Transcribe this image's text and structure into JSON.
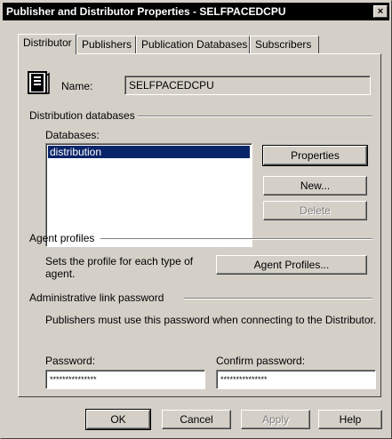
{
  "window": {
    "title": "Publisher and Distributor Properties - SELFPACEDCPU",
    "close_label": "×"
  },
  "tabs": [
    {
      "label": "Distributor"
    },
    {
      "label": "Publishers"
    },
    {
      "label": "Publication Databases"
    },
    {
      "label": "Subscribers"
    }
  ],
  "distributor": {
    "name_label": "Name:",
    "name_value": "SELFPACEDCPU",
    "db_group_label": "Distribution databases",
    "databases_label": "Databases:",
    "databases": [
      "distribution"
    ],
    "properties_label": "Properties",
    "new_label": "New...",
    "delete_label": "Delete",
    "agent_group_label": "Agent profiles",
    "agent_description": "Sets the profile for each type of agent.",
    "agent_profiles_label": "Agent Profiles...",
    "password_group_label": "Administrative link password",
    "password_description": "Publishers must use this password when connecting to the Distributor.",
    "password_label": "Password:",
    "password_value": "***************",
    "confirm_label": "Confirm password:",
    "confirm_value": "***************"
  },
  "footer": {
    "ok_label": "OK",
    "cancel_label": "Cancel",
    "apply_label": "Apply",
    "help_label": "Help"
  }
}
